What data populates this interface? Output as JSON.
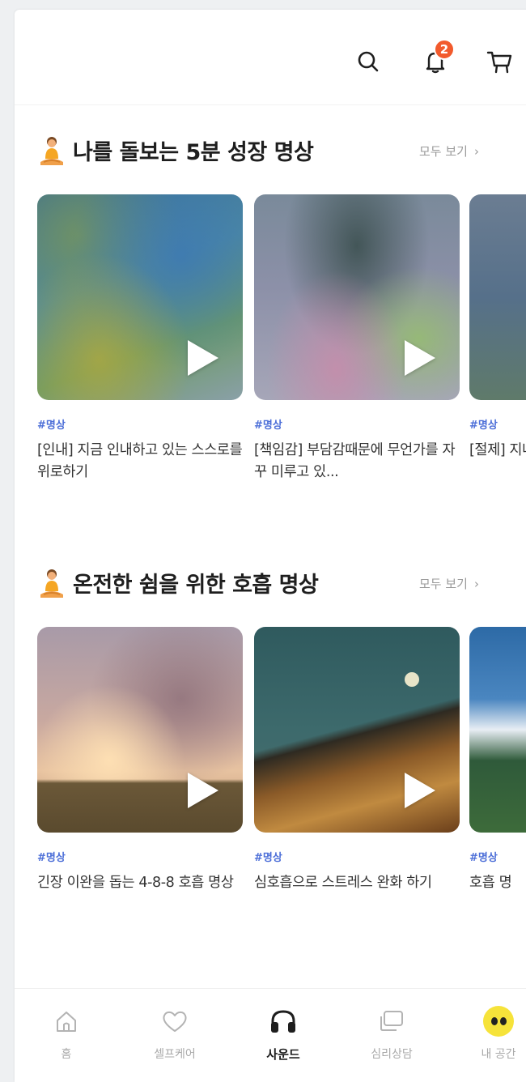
{
  "header": {
    "search_icon": "search-icon",
    "bell_icon": "bell-icon",
    "notification_count": "2",
    "cart_icon": "cart-icon",
    "badge_color": "#f25a2c"
  },
  "sections": [
    {
      "title": "나를 돌보는 5분 성장 명상",
      "emoji_icon": "meditation-person-icon",
      "see_all": "모두 보기",
      "cards": [
        {
          "tag": "#명상",
          "title": "[인내] 지금 인내하고 있는 스스로를 위로하기"
        },
        {
          "tag": "#명상",
          "title": "[책임감] 부담감때문에 무언가를 자꾸 미루고 있..."
        },
        {
          "tag": "#명상",
          "title": "[절제] 지나친"
        }
      ]
    },
    {
      "title": "온전한 쉼을 위한 호흡 명상",
      "emoji_icon": "meditation-person-icon",
      "see_all": "모두 보기",
      "cards": [
        {
          "tag": "#명상",
          "title": "긴장 이완을 돕는 4-8-8 호흡 명상"
        },
        {
          "tag": "#명상",
          "title": "심호흡으로 스트레스 완화 하기"
        },
        {
          "tag": "#명상",
          "title": "호흡 명"
        }
      ]
    }
  ],
  "bottom_nav": {
    "items": [
      {
        "label": "홈",
        "icon": "home-icon",
        "active": false
      },
      {
        "label": "셀프케어",
        "icon": "heart-icon",
        "active": false
      },
      {
        "label": "사운드",
        "icon": "headphones-icon",
        "active": true
      },
      {
        "label": "심리상담",
        "icon": "chat-icon",
        "active": false
      },
      {
        "label": "내 공간",
        "icon": "eyes-avatar-icon",
        "active": false
      }
    ]
  },
  "colors": {
    "tag": "#4d6fd8",
    "accent_yellow": "#f6e33a",
    "active_nav": "#1e1e1e",
    "inactive_nav": "#a9a9a9"
  }
}
